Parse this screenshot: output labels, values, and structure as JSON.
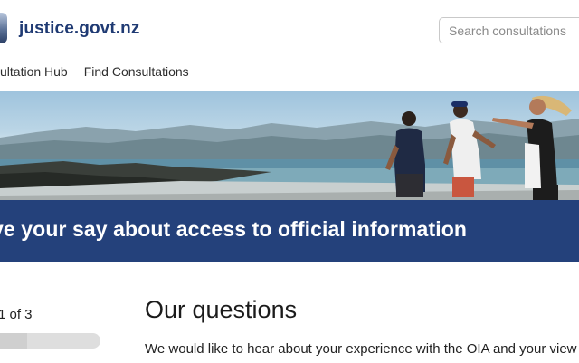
{
  "site": {
    "name": "justice.govt.nz"
  },
  "search": {
    "placeholder": "Search consultations"
  },
  "nav": {
    "items": [
      "sultation Hub",
      "Find Consultations"
    ]
  },
  "banner": {
    "title": "ve your say about access to official information"
  },
  "progress": {
    "label": "1 of 3",
    "fraction": 0.33
  },
  "main": {
    "heading": "Our questions",
    "intro": "We would like to hear about your experience with the OIA and your view"
  },
  "colors": {
    "brand": "#1f3a73",
    "banner": "#24417b"
  }
}
